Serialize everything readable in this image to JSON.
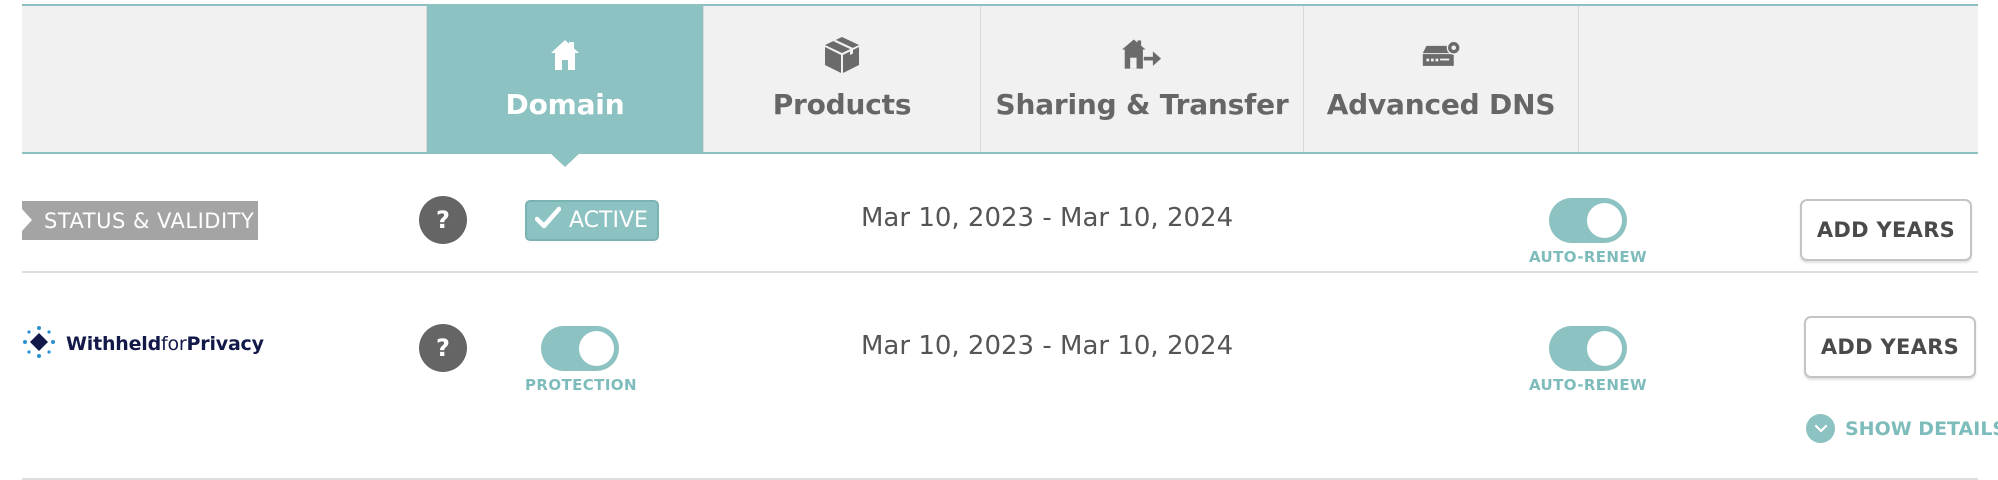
{
  "tabs": [
    {
      "label": "Domain",
      "icon": "home-icon",
      "active": true
    },
    {
      "label": "Products",
      "icon": "box-icon",
      "active": false
    },
    {
      "label": "Sharing & Transfer",
      "icon": "house-transfer-icon",
      "active": false
    },
    {
      "label": "Advanced DNS",
      "icon": "server-gear-icon",
      "active": false
    }
  ],
  "status_row": {
    "label": "STATUS & VALIDITY",
    "help": "?",
    "badge": "ACTIVE",
    "dates": "Mar 10, 2023 - Mar 10, 2024",
    "auto_renew_label": "AUTO-RENEW",
    "auto_renew_on": true,
    "add_years_label": "ADD YEARS"
  },
  "privacy_row": {
    "brand_bold": "Withheld",
    "brand_light": "for",
    "brand_bold2": "Privacy",
    "help": "?",
    "protection_label": "PROTECTION",
    "protection_on": true,
    "dates": "Mar 10, 2023 - Mar 10, 2024",
    "auto_renew_label": "AUTO-RENEW",
    "auto_renew_on": true,
    "add_years_label": "ADD YEARS",
    "show_details_label": "SHOW DETAILS"
  },
  "colors": {
    "accent": "#8cc2c1",
    "accent_text": "#7dbcbb",
    "tab_bg": "#f1f1f1",
    "label_gray": "#a4a4a4",
    "help_gray": "#656565",
    "brand_navy": "#131a4a"
  }
}
